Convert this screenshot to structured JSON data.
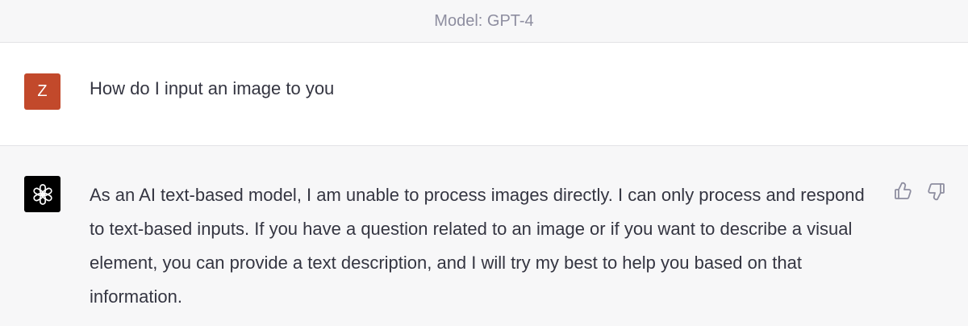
{
  "header": {
    "model_label": "Model: GPT-4"
  },
  "user_message": {
    "avatar_initial": "Z",
    "avatar_color": "#c2492b",
    "text": "How do I input an image to you"
  },
  "assistant_message": {
    "avatar_icon": "openai-logo-icon",
    "text": "As an AI text-based model, I am unable to process images directly. I can only process and respond to text-based inputs. If you have a question related to an image or if you want to describe a visual element, you can provide a text description, and I will try my best to help you based on that information.",
    "actions": [
      "thumbs-up-icon",
      "thumbs-down-icon"
    ]
  }
}
